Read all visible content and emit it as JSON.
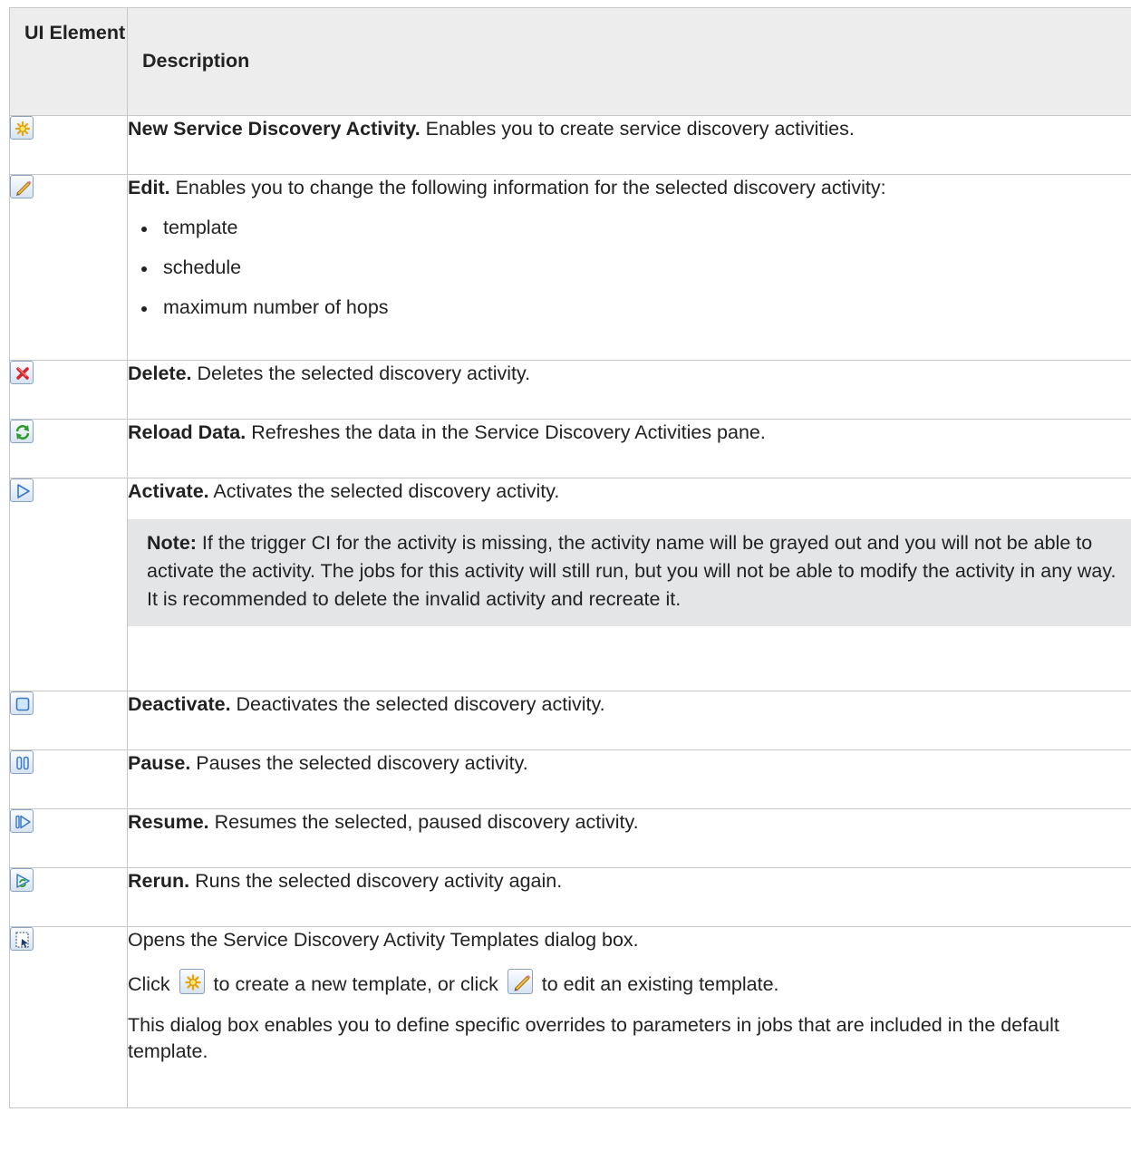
{
  "header": {
    "ui_element": "UI Element",
    "description": "Description"
  },
  "rows": [
    {
      "icon": "new-star-icon",
      "term": "New Service Discovery Activity.",
      "text": " Enables you to create service discovery activities."
    },
    {
      "icon": "edit-pencil-icon",
      "term": "Edit.",
      "text": " Enables you to change the following information for the selected discovery activity:",
      "bullets": [
        "template",
        "schedule",
        "maximum number of hops"
      ]
    },
    {
      "icon": "delete-x-icon",
      "term": "Delete.",
      "text": " Deletes the selected discovery activity."
    },
    {
      "icon": "reload-icon",
      "term": "Reload Data.",
      "text": " Refreshes the data in the Service Discovery Activities pane."
    },
    {
      "icon": "activate-play-icon",
      "term": "Activate.",
      "text": " Activates the selected discovery activity.",
      "note": {
        "label": "Note:",
        "text": " If the trigger CI for the activity is missing, the activity name will be grayed out and you will not be able to activate the activity. The jobs for this activity will still run, but you will not be able to modify the activity in any way. It is recommended to delete the invalid activity and recreate it."
      }
    },
    {
      "icon": "deactivate-stop-icon",
      "term": "Deactivate.",
      "text": " Deactivates the selected discovery activity."
    },
    {
      "icon": "pause-icon",
      "term": "Pause.",
      "text": " Pauses the selected discovery activity."
    },
    {
      "icon": "resume-icon",
      "term": "Resume.",
      "text": " Resumes the selected, paused discovery activity."
    },
    {
      "icon": "rerun-icon",
      "term": "Rerun.",
      "text": " Runs the selected discovery activity again."
    },
    {
      "icon": "templates-icon",
      "text": "Opens the Service Discovery Activity Templates dialog box.",
      "click_line": {
        "part1": "Click ",
        "part2": " to create a new template, or click ",
        "part3": " to edit an existing template."
      },
      "text2": "This dialog box enables you to define specific overrides to parameters in jobs that are included in the default template."
    }
  ],
  "colors": {
    "header_bg": "#ededed",
    "note_bg": "#e3e5e6",
    "border": "#c8c8c8",
    "icon_border": "#8aa2bd"
  }
}
